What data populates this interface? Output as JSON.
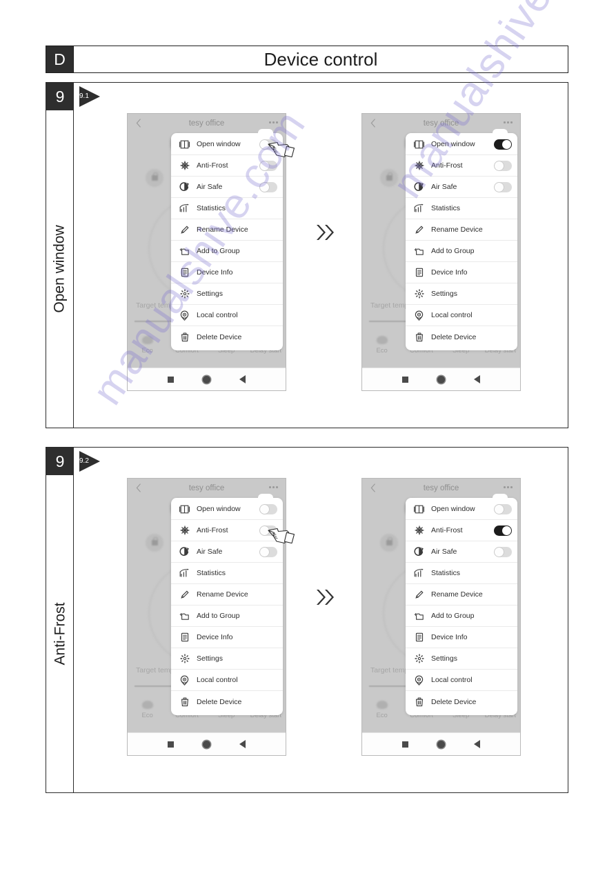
{
  "header": {
    "letter": "D",
    "title": "Device control"
  },
  "sections": [
    {
      "step": "9",
      "substep": "9.1",
      "vertical_label": "Open window",
      "before": {
        "app_title": "tesy office",
        "back_icon": "chevron-left-icon",
        "more_icon": "more-options-icon",
        "background": {
          "target_temp_label": "Target temp",
          "modes": [
            "Eco",
            "Comfort",
            "Sleep",
            "Delay start"
          ],
          "lock_icon": "lock-icon"
        },
        "menu": [
          {
            "icon": "open-window-icon",
            "label": "Open window",
            "toggle": "off"
          },
          {
            "icon": "snowflake-icon",
            "label": "Anti-Frost",
            "toggle": "off"
          },
          {
            "icon": "air-safe-icon",
            "label": "Air Safe",
            "toggle": "off"
          },
          {
            "icon": "bar-chart-icon",
            "label": "Statistics",
            "toggle": null
          },
          {
            "icon": "pencil-icon",
            "label": "Rename Device",
            "toggle": null
          },
          {
            "icon": "folder-add-icon",
            "label": "Add to Group",
            "toggle": null
          },
          {
            "icon": "document-icon",
            "label": "Device Info",
            "toggle": null
          },
          {
            "icon": "gear-icon",
            "label": "Settings",
            "toggle": null
          },
          {
            "icon": "location-pin-icon",
            "label": "Local control",
            "toggle": null
          },
          {
            "icon": "trash-icon",
            "label": "Delete Device",
            "toggle": null
          }
        ],
        "nav": [
          "square-icon",
          "circle-icon",
          "back-triangle-icon"
        ],
        "cursor": {
          "icon": "pointing-hand-icon",
          "target": "Open window"
        }
      },
      "transition_icon": "double-chevron-right-icon",
      "after": {
        "app_title": "tesy office",
        "back_icon": "chevron-left-icon",
        "more_icon": "more-options-icon",
        "background": {
          "target_temp_label": "Target temp",
          "modes": [
            "Eco",
            "Comfort",
            "Sleep",
            "Delay start"
          ],
          "lock_icon": "lock-icon"
        },
        "menu": [
          {
            "icon": "open-window-icon",
            "label": "Open window",
            "toggle": "on"
          },
          {
            "icon": "snowflake-icon",
            "label": "Anti-Frost",
            "toggle": "off"
          },
          {
            "icon": "air-safe-icon",
            "label": "Air Safe",
            "toggle": "off"
          },
          {
            "icon": "bar-chart-icon",
            "label": "Statistics",
            "toggle": null
          },
          {
            "icon": "pencil-icon",
            "label": "Rename Device",
            "toggle": null
          },
          {
            "icon": "folder-add-icon",
            "label": "Add to Group",
            "toggle": null
          },
          {
            "icon": "document-icon",
            "label": "Device Info",
            "toggle": null
          },
          {
            "icon": "gear-icon",
            "label": "Settings",
            "toggle": null
          },
          {
            "icon": "location-pin-icon",
            "label": "Local control",
            "toggle": null
          },
          {
            "icon": "trash-icon",
            "label": "Delete Device",
            "toggle": null
          }
        ],
        "nav": [
          "square-icon",
          "circle-icon",
          "back-triangle-icon"
        ]
      }
    },
    {
      "step": "9",
      "substep": "9.2",
      "vertical_label": "Anti-Frost",
      "before": {
        "app_title": "tesy office",
        "back_icon": "chevron-left-icon",
        "more_icon": "more-options-icon",
        "background": {
          "target_temp_label": "Target temp",
          "modes": [
            "Eco",
            "Comfort",
            "Sleep",
            "Delay start"
          ],
          "lock_icon": "lock-icon"
        },
        "menu": [
          {
            "icon": "open-window-icon",
            "label": "Open window",
            "toggle": "off"
          },
          {
            "icon": "snowflake-icon",
            "label": "Anti-Frost",
            "toggle": "off"
          },
          {
            "icon": "air-safe-icon",
            "label": "Air Safe",
            "toggle": "off"
          },
          {
            "icon": "bar-chart-icon",
            "label": "Statistics",
            "toggle": null
          },
          {
            "icon": "pencil-icon",
            "label": "Rename Device",
            "toggle": null
          },
          {
            "icon": "folder-add-icon",
            "label": "Add to Group",
            "toggle": null
          },
          {
            "icon": "document-icon",
            "label": "Device Info",
            "toggle": null
          },
          {
            "icon": "gear-icon",
            "label": "Settings",
            "toggle": null
          },
          {
            "icon": "location-pin-icon",
            "label": "Local control",
            "toggle": null
          },
          {
            "icon": "trash-icon",
            "label": "Delete Device",
            "toggle": null
          }
        ],
        "nav": [
          "square-icon",
          "circle-icon",
          "back-triangle-icon"
        ],
        "cursor": {
          "icon": "pointing-hand-icon",
          "target": "Anti-Frost"
        }
      },
      "transition_icon": "double-chevron-right-icon",
      "after": {
        "app_title": "tesy office",
        "back_icon": "chevron-left-icon",
        "more_icon": "more-options-icon",
        "background": {
          "target_temp_label": "Target temp",
          "modes": [
            "Eco",
            "Comfort",
            "Sleep",
            "Delay start"
          ],
          "lock_icon": "lock-icon"
        },
        "menu": [
          {
            "icon": "open-window-icon",
            "label": "Open window",
            "toggle": "off"
          },
          {
            "icon": "snowflake-icon",
            "label": "Anti-Frost",
            "toggle": "on"
          },
          {
            "icon": "air-safe-icon",
            "label": "Air Safe",
            "toggle": "off"
          },
          {
            "icon": "bar-chart-icon",
            "label": "Statistics",
            "toggle": null
          },
          {
            "icon": "pencil-icon",
            "label": "Rename Device",
            "toggle": null
          },
          {
            "icon": "folder-add-icon",
            "label": "Add to Group",
            "toggle": null
          },
          {
            "icon": "document-icon",
            "label": "Device Info",
            "toggle": null
          },
          {
            "icon": "gear-icon",
            "label": "Settings",
            "toggle": null
          },
          {
            "icon": "location-pin-icon",
            "label": "Local control",
            "toggle": null
          },
          {
            "icon": "trash-icon",
            "label": "Delete Device",
            "toggle": null
          }
        ],
        "nav": [
          "square-icon",
          "circle-icon",
          "back-triangle-icon"
        ]
      }
    }
  ],
  "watermark": {
    "text": "manualshive.com"
  },
  "colors": {
    "ink": "#1d1d1d",
    "dark_box": "#2e2e2e",
    "screen_bg": "#c9c9c9",
    "menu_bg": "#ffffff",
    "toggle_on": "#1c1c1c",
    "toggle_off": "#dcdcdc",
    "watermark": "#7b6fd0"
  }
}
